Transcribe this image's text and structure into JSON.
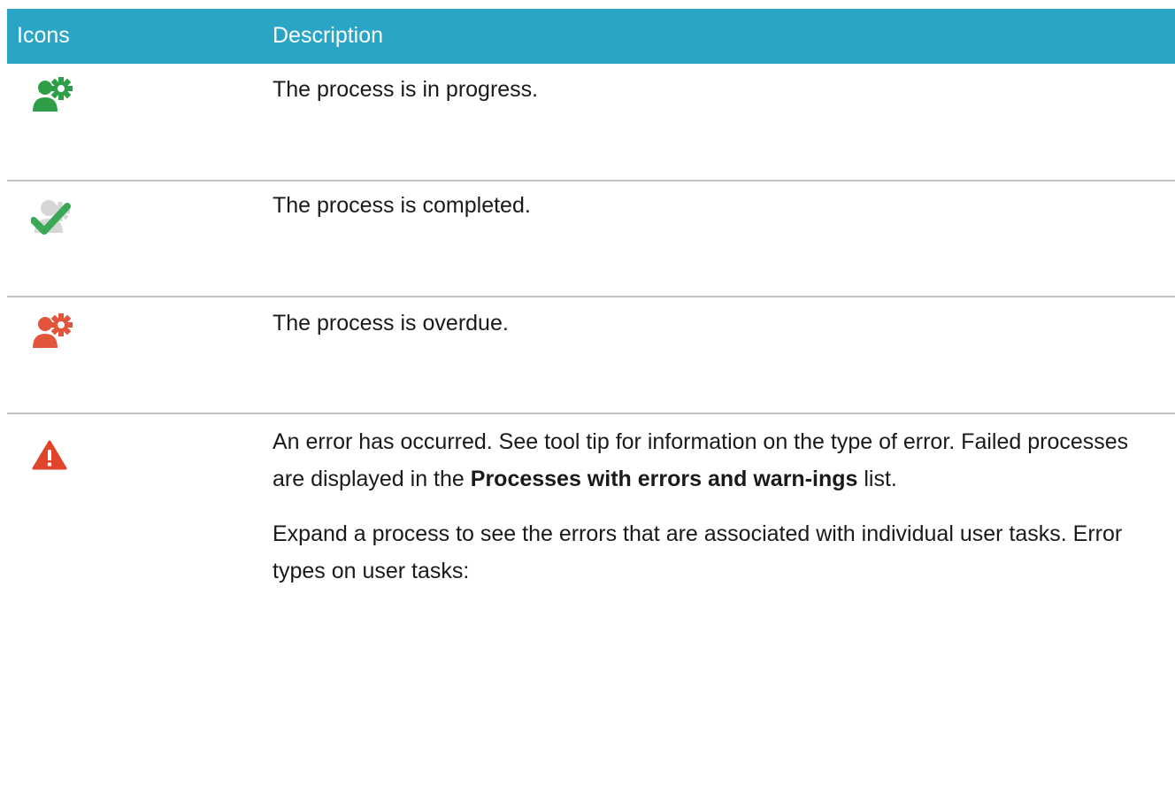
{
  "header": {
    "icons_label": "Icons",
    "description_label": "Description"
  },
  "rows": [
    {
      "icon": "process-in-progress-icon",
      "icon_color": "#2e9e49",
      "description": "The process is in progress."
    },
    {
      "icon": "process-completed-icon",
      "icon_color": "#3aa855",
      "description": "The process is completed."
    },
    {
      "icon": "process-overdue-icon",
      "icon_color": "#e2553a",
      "description": "The process is overdue."
    },
    {
      "icon": "error-warning-icon",
      "icon_color": "#e0442a",
      "description_part1": "An error has occurred. See tool tip for information on the type of error. Failed processes are displayed in the ",
      "description_bold": "Processes with errors and warn-ings",
      "description_part2": " list.",
      "description_2": "Expand a process to see the errors that are associated with individual user tasks. Error types on user tasks:"
    }
  ]
}
